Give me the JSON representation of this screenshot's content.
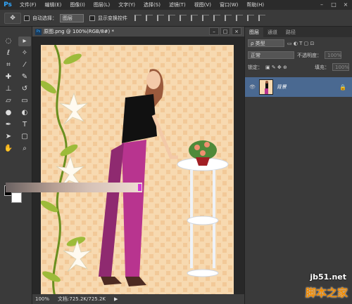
{
  "app": {
    "logo": "Ps",
    "menu": [
      "文件(F)",
      "编辑(E)",
      "图像(I)",
      "图层(L)",
      "文字(Y)",
      "选择(S)",
      "滤镜(T)",
      "视图(V)",
      "窗口(W)",
      "帮助(H)"
    ],
    "window_controls": [
      "–",
      "□",
      "×"
    ]
  },
  "options_bar": {
    "tool": "move-tool",
    "auto_select_label": "自动选择：",
    "auto_select_value": "图层",
    "show_transform_label": "显示变换控件"
  },
  "document": {
    "tab_icon": "Ps",
    "title": "原图.png @ 100%(RGB/8#) *",
    "controls": [
      "–",
      "□",
      "×"
    ],
    "canvas_bg": "#f7d9b0"
  },
  "status": {
    "zoom": "100%",
    "doc_info": "文档:725.2K/725.2K"
  },
  "layers_panel": {
    "tabs": [
      "图层",
      "通道",
      "路径"
    ],
    "filter_label": "ρ 类型",
    "blend_mode": "正常",
    "opacity_label": "不透明度：",
    "opacity_value": "100%",
    "lock_label": "锁定：",
    "fill_label": "填充：",
    "fill_value": "100%",
    "layers": [
      {
        "name": "背景",
        "visible": true,
        "locked": true
      }
    ]
  },
  "colors": {
    "foreground": "#000000",
    "background": "#ffffff",
    "accent": "#31a8ff",
    "layer_selected": "#4a6991"
  },
  "watermarks": {
    "site": "jb51.net",
    "chinese": "脚本之家"
  }
}
